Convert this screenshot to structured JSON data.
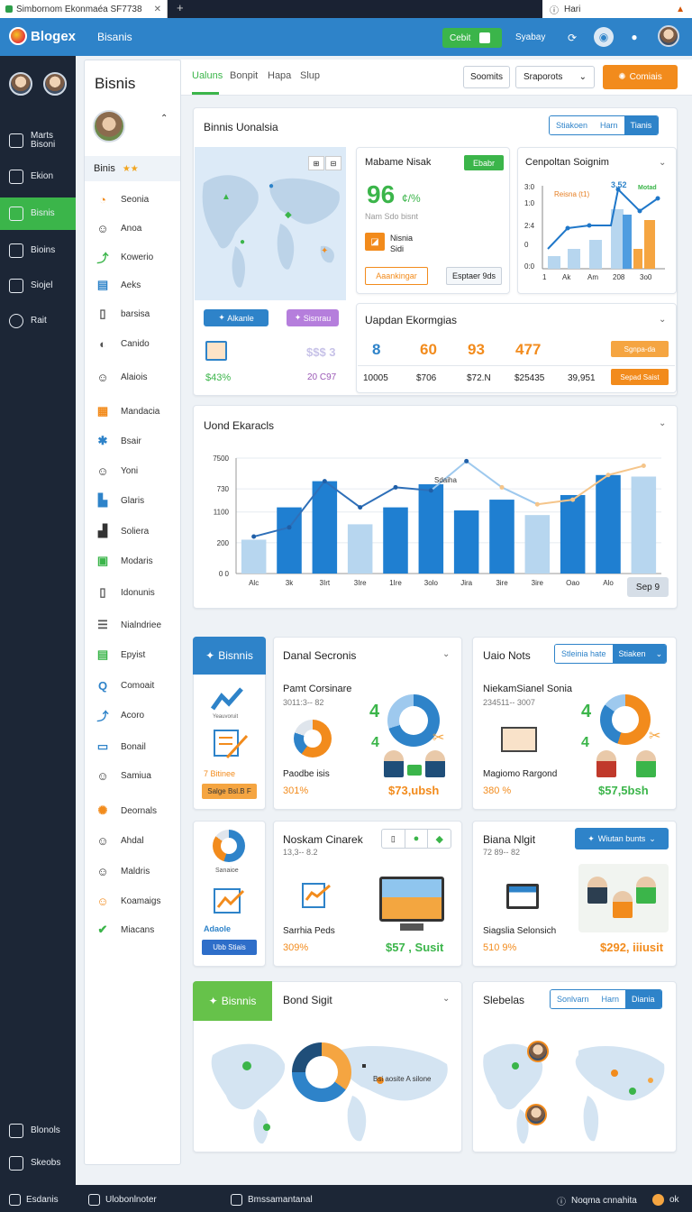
{
  "browser": {
    "tab1_title": "Simbornom Ekonmaéa SF7738",
    "tab2_title": "Hari"
  },
  "header": {
    "logo": "Blogex",
    "subtitle": "Bisanis",
    "credit_btn": "Cebit",
    "link": "Syabay"
  },
  "rail": {
    "items": [
      {
        "label": "Marts Bisoni",
        "icon": "home-icon"
      },
      {
        "label": "Ekion",
        "icon": "briefcase-icon"
      },
      {
        "label": "Bisnis",
        "icon": "wallet-icon"
      },
      {
        "label": "Bioins",
        "icon": "building-icon"
      },
      {
        "label": "Siojel",
        "icon": "document-icon"
      },
      {
        "label": "Rait",
        "icon": "plus-circle-icon"
      }
    ],
    "bottom": [
      {
        "label": "Blonols",
        "icon": "home-icon"
      },
      {
        "label": "Skeobs",
        "icon": "page-icon"
      }
    ]
  },
  "sidebar": {
    "title": "Bisnis",
    "section": "Binis",
    "items": [
      "Seonia",
      "Anoa",
      "Kowerio",
      "Aeks",
      "barsisa",
      "Canido",
      "Alaiois",
      "Mandacia",
      "Bsair",
      "Yoni",
      "Glaris",
      "Soliera",
      "Modaris",
      "Idonunis",
      "Nialndriee",
      "Epyist",
      "Comoait",
      "Acoro",
      "Bonail",
      "Samiua",
      "Deornals",
      "Ahdal",
      "Maldris",
      "Koamaigs",
      "Miacans"
    ]
  },
  "main": {
    "tabs": [
      "Ualuns",
      "Bonpit",
      "Hapa",
      "Slup"
    ],
    "select1": "Soomits",
    "select2": "Sraporots",
    "orange_btn": "Comiais"
  },
  "overview": {
    "title": "Binnis Uonalsia",
    "seg": [
      "Stiakoen",
      "Harn",
      "Tianis"
    ],
    "map_btn1": "Alkanle",
    "map_btn2": "Sisnrau",
    "map_val_left": "$43%",
    "map_val_right": "20 C97",
    "map_val_right_top": "$$$ 3"
  },
  "metric_card": {
    "title": "Mabame Nisak",
    "badge": "Ebabr",
    "big": "96",
    "unit": "¢/%",
    "sub": "Nam Sdo bisnt",
    "note1": "Nisnia",
    "note2": "Sidi",
    "btn1": "Aaankingar",
    "btn2": "Esptaer 9ds"
  },
  "comparison_chart": {
    "title": "Cenpoltan Soignim",
    "legend_a": "Reisna (t1)",
    "legend_b": "Motad",
    "peak_label": "3.52"
  },
  "update_card": {
    "title": "Uapdan Ekormgias",
    "stats": [
      "8",
      "60",
      "93",
      "477"
    ],
    "values": [
      "10005",
      "$706",
      "$72.N",
      "$25435",
      "39,951"
    ],
    "btn1": "Sgnpa-da",
    "btn2": "Sepad Saist"
  },
  "trend": {
    "title": "Uond Ekaracls",
    "annotation": "Sdaiha",
    "button": "Sep 9"
  },
  "chart_data": {
    "type": "bar",
    "title": "Uond Ekaracls",
    "categories": [
      "Alc",
      "3k",
      "3Irt",
      "3Ire",
      "1Ire",
      "3olo",
      "Jira",
      "3ire",
      "3ire",
      "Oao",
      "Alo",
      "7Ap"
    ],
    "y_tick_labels": [
      "0 0",
      "200",
      "1100",
      "730",
      "7500"
    ],
    "ylim": [
      0,
      7500
    ],
    "series": [
      {
        "values": [
          2200,
          4300,
          6000,
          3200,
          4300,
          5800,
          4100,
          4800,
          3800,
          5100,
          6400,
          6300
        ]
      },
      {
        "values": [
          2400,
          3000,
          6000,
          4300,
          5600,
          5400,
          7300,
          5600,
          4500,
          4800,
          6400,
          7000
        ]
      }
    ],
    "grid": true
  },
  "row2": {
    "card_a": {
      "tag": "Bisnnis",
      "caption": "Yeauvoruit",
      "label": "7 Bitinee",
      "btn": "Salge Bsl.B F"
    },
    "card_b": {
      "title": "Danal Secronis",
      "subtitle": "Pamt Corsinare",
      "code": "3011:3-- 82",
      "caption": "Paodbe isis",
      "pct": "301%",
      "amount": "$73,ubsh"
    },
    "card_c": {
      "title": "Uaio Nots",
      "seg": [
        "Stleinia hate",
        "Stiaken"
      ],
      "subtitle": "NiekamSianel Sonia",
      "code": "234511-- 3007",
      "caption": "Magiomo Rargond",
      "pct": "380 %",
      "amount": "$57,5bsh"
    }
  },
  "row3": {
    "card_a": {
      "caption": "Sanaioe",
      "label": "Adaole",
      "btn": "Ubb Stiais"
    },
    "card_b": {
      "title": "Noskam Cinarek",
      "code": "13,3-- 8.2",
      "caption": "Sarrhia Peds",
      "pct": "309%",
      "amount": "$57 , Susit"
    },
    "card_c": {
      "title": "Biana Nlgit",
      "btn": "Wiutan bunts",
      "code": "72 89-- 82",
      "caption": "Siagslia Selonsich",
      "pct": "510 9%",
      "amount": "$292, iiiusit"
    }
  },
  "row4": {
    "card_a": {
      "tag": "Bisnnis",
      "title": "Bond Sigit",
      "legend": "Bsi aosite A silone"
    },
    "card_b": {
      "title": "Slebelas",
      "seg": [
        "Sonlvarn",
        "Harn",
        "Diania"
      ]
    }
  },
  "bottombar": {
    "items": [
      "Esdanis",
      "Ulobonlnoter",
      "Bmssamantanal"
    ],
    "right": "Noqma cnnahita",
    "badge": "ok"
  },
  "colors": {
    "accent": "#2e83c9",
    "green": "#3bb54a",
    "orange": "#f28b1c",
    "rail": "#1c2636"
  }
}
